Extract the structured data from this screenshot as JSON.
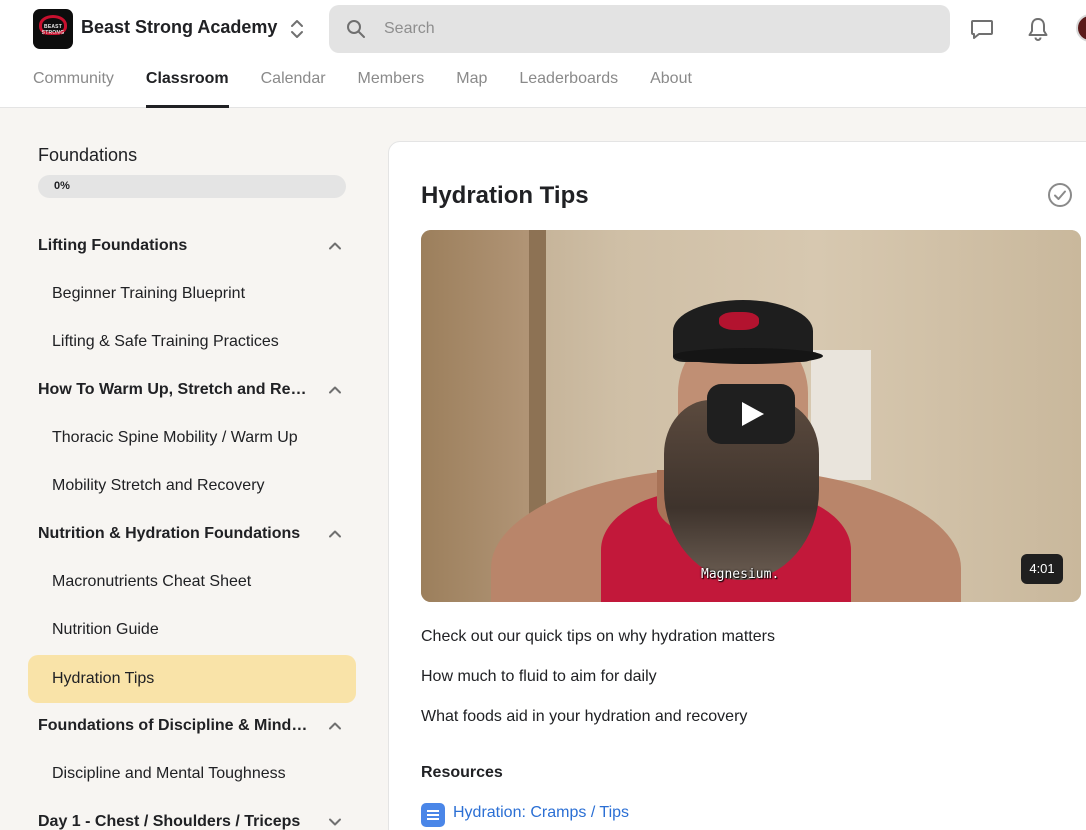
{
  "header": {
    "group_name": "Beast Strong Academy",
    "logo_text_top": "BEAST STRONG",
    "logo_text_bottom": "ACADEMY",
    "search_placeholder": "Search",
    "icons": [
      "chat-icon",
      "bell-icon"
    ]
  },
  "tabs": [
    {
      "label": "Community",
      "active": false
    },
    {
      "label": "Classroom",
      "active": true
    },
    {
      "label": "Calendar",
      "active": false
    },
    {
      "label": "Members",
      "active": false
    },
    {
      "label": "Map",
      "active": false
    },
    {
      "label": "Leaderboards",
      "active": false
    },
    {
      "label": "About",
      "active": false
    }
  ],
  "sidebar": {
    "course_title": "Foundations",
    "progress_label": "0%",
    "progress_value": 0,
    "modules": [
      {
        "title": "Lifting Foundations",
        "expanded": true,
        "lessons": [
          "Beginner Training Blueprint",
          "Lifting & Safe Training Practices"
        ]
      },
      {
        "title": "How To Warm Up, Stretch and Recover",
        "expanded": true,
        "lessons": [
          "Thoracic Spine Mobility / Warm Up",
          "Mobility Stretch and Recovery"
        ]
      },
      {
        "title": "Nutrition & Hydration Foundations",
        "expanded": true,
        "lessons": [
          "Macronutrients Cheat Sheet",
          "Nutrition Guide",
          "Hydration Tips"
        ]
      },
      {
        "title": "Foundations of Discipline & Mindset",
        "expanded": true,
        "lessons": [
          "Discipline and Mental Toughness"
        ]
      },
      {
        "title": "Day 1 - Chest / Shoulders / Triceps",
        "expanded": false,
        "lessons": []
      }
    ],
    "active_lesson": "Hydration Tips"
  },
  "lesson": {
    "title": "Hydration Tips",
    "video": {
      "duration": "4:01",
      "caption": "Magnesium."
    },
    "paragraphs": [
      "Check out our quick tips on why hydration matters",
      "How much to fluid to aim for daily",
      "What foods aid in your hydration and recovery"
    ],
    "resources_heading": "Resources",
    "resources": [
      {
        "label": "Hydration: Cramps / Tips",
        "icon": "document-icon"
      }
    ]
  },
  "colors": {
    "active_lesson_bg": "#f9e3a8",
    "link": "#2b6fd4",
    "page_bg": "#f7f5f2"
  }
}
